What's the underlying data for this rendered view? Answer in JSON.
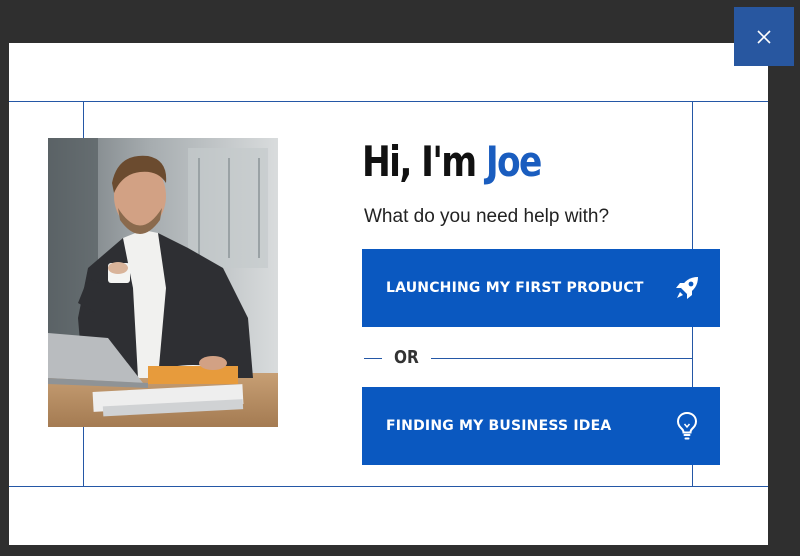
{
  "popup": {
    "headline_prefix": "Hi, I'm ",
    "headline_name": "Joe",
    "subtitle": "What do you need help with?",
    "option_primary": {
      "label": "LAUNCHING MY FIRST PRODUCT",
      "icon": "rocket-icon"
    },
    "divider_text": "OR",
    "option_secondary": {
      "label": "FINDING MY BUSINESS IDEA",
      "icon": "lightbulb-icon"
    },
    "close_icon": "close-icon",
    "photo": "man-with-coffee-cup-at-laptop"
  },
  "colors": {
    "overlay": "#2f2f2f",
    "accent_blue": "#0a58c0",
    "name_blue": "#1a5dbf",
    "close_blue": "#2857a0",
    "guide_lines": "#2457a6"
  }
}
